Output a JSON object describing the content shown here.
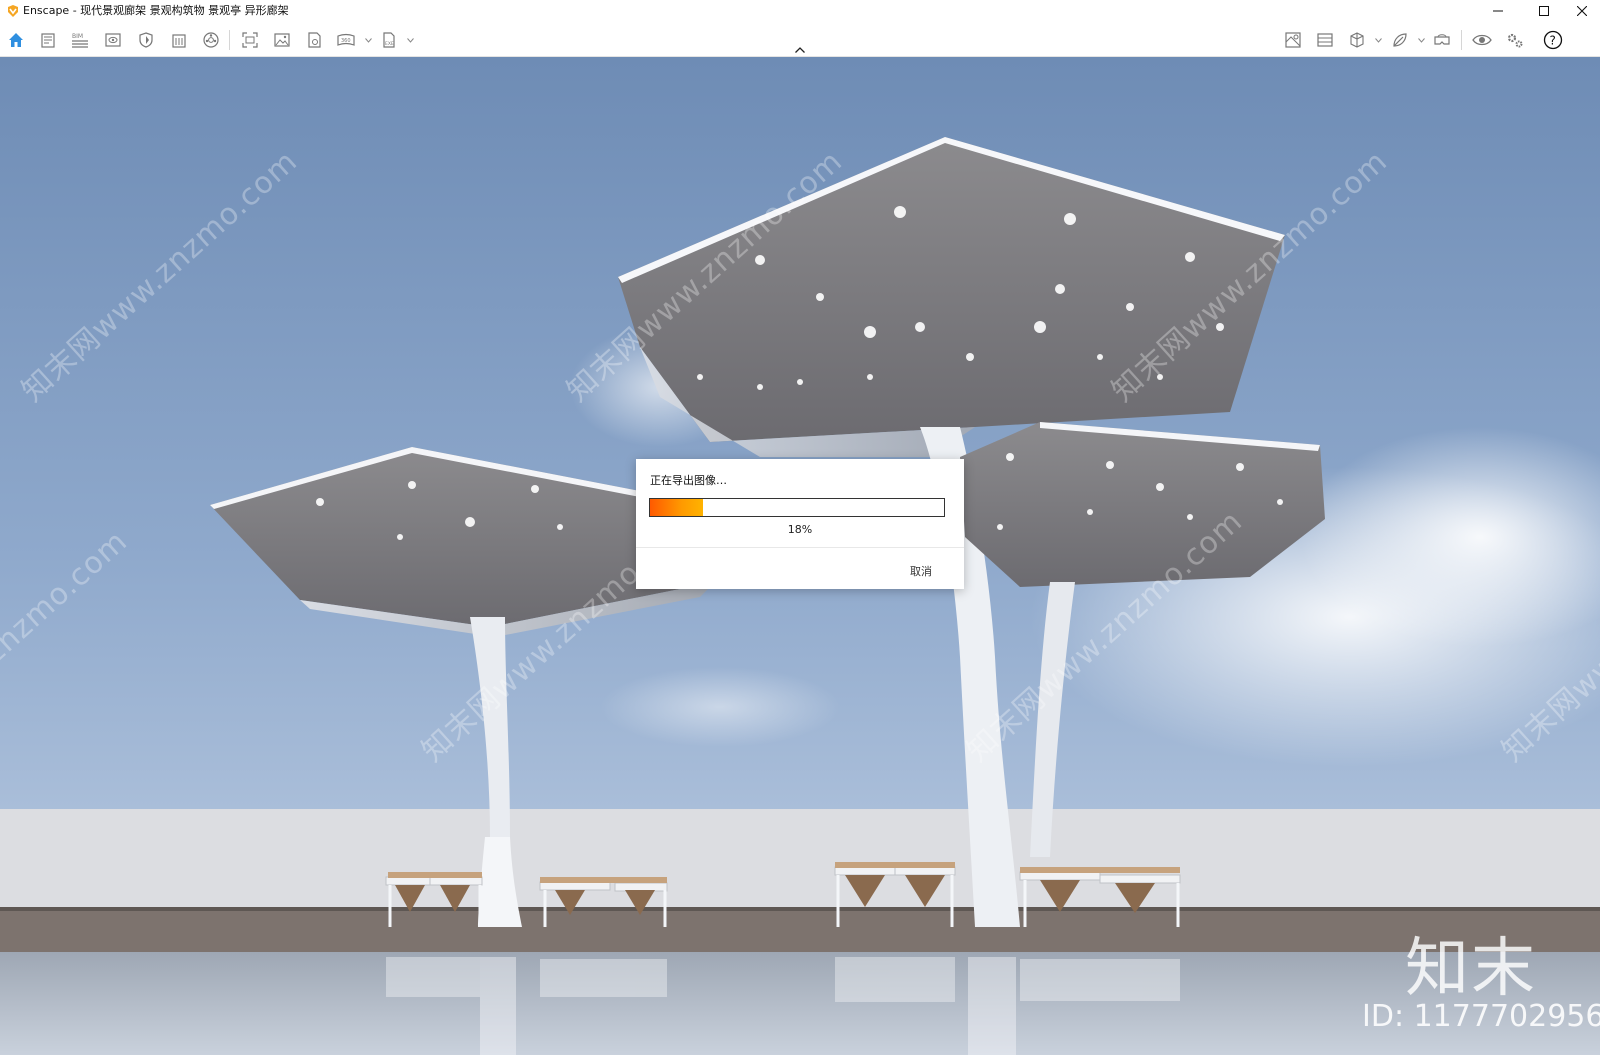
{
  "window": {
    "title": "Enscape - 现代景观廊架 景观构筑物 景观亭 异形廊架",
    "controls": [
      "minimize",
      "maximize",
      "close"
    ]
  },
  "toolbar": {
    "left_icons": [
      "home-icon",
      "notes-icon",
      "bim-icon",
      "view-icon",
      "shield-icon",
      "building-icon",
      "asset-library-icon",
      "fullscreen-capture-icon",
      "screenshot-icon",
      "batch-render-icon",
      "panorama-icon",
      "export-file-icon"
    ],
    "right_icons": [
      "material-editor-icon",
      "visual-settings-icon",
      "cube-view-icon",
      "atmosphere-icon",
      "vr-headset-icon",
      "live-update-icon",
      "settings-icon",
      "help-icon"
    ]
  },
  "dialog": {
    "title": "正在导出图像…",
    "progress": 0.18,
    "percent_label": "18%",
    "cancel_label": "取消"
  },
  "watermarks": {
    "diagonal_text": "知末网www.znzmo.com",
    "logo_text": "知末",
    "id_text": "ID: 1177702956"
  }
}
